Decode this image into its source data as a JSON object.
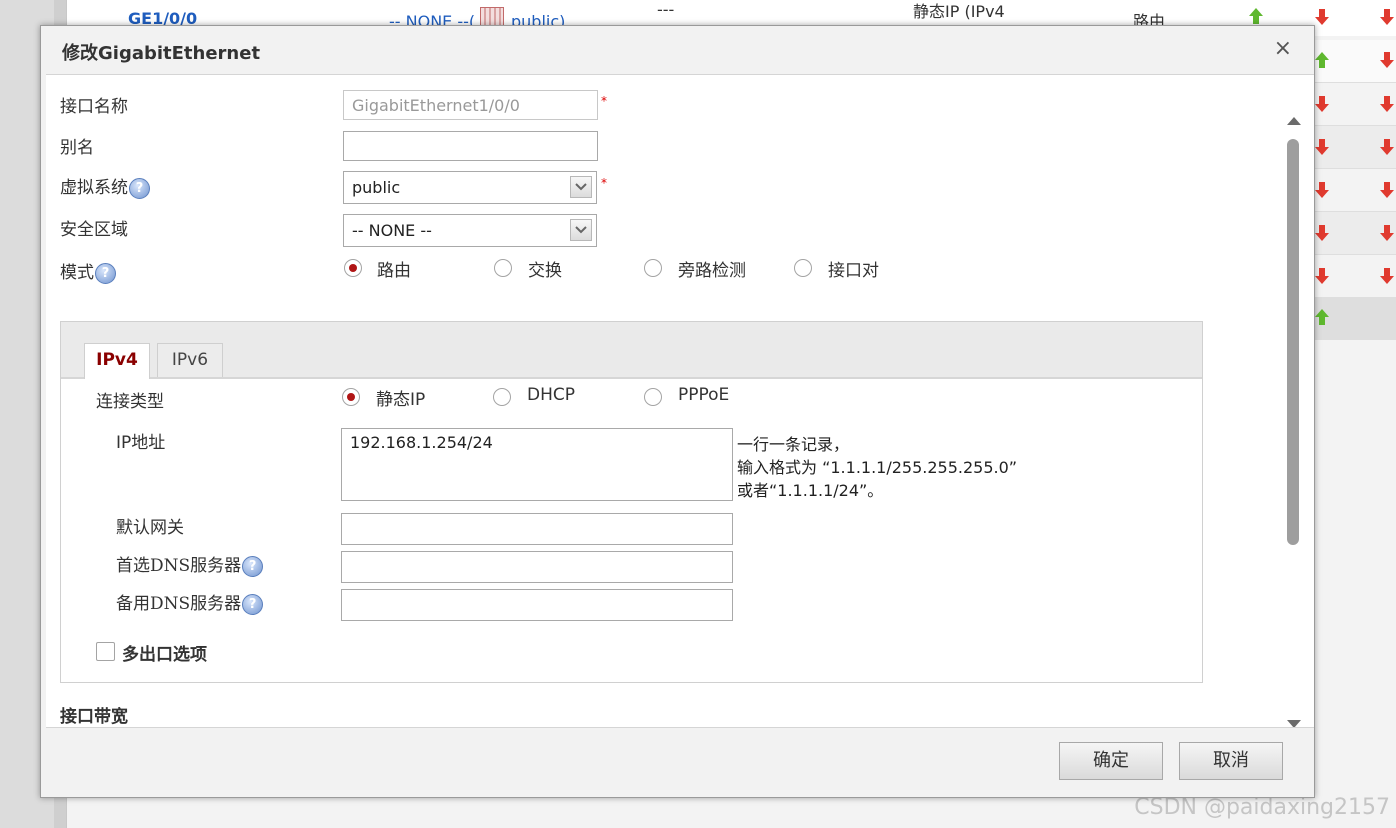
{
  "background": {
    "row0": {
      "interface": "GE1/0/0",
      "zone_text": "-- NONE --(",
      "vsys_link": "public)",
      "dashes": "---",
      "ip_text_1": "静态IP (IPv4",
      "ip_text_2": "静态IP (IPv",
      "mode": "路由"
    },
    "watermark": "CSDN @paidaxing2157"
  },
  "dialog": {
    "title": "修改GigabitEthernet",
    "close_glyph": "×",
    "fields": {
      "interface_name": {
        "label": "接口名称",
        "value": "GigabitEthernet1/0/0",
        "required_mark": "*"
      },
      "alias": {
        "label": "别名",
        "value": ""
      },
      "vsys": {
        "label": "虚拟系统",
        "help": "?",
        "value": "public",
        "required_mark": "*"
      },
      "zone": {
        "label": "安全区域",
        "value": "-- NONE --"
      },
      "mode": {
        "label": "模式",
        "help": "?",
        "options": [
          "路由",
          "交换",
          "旁路检测",
          "接口对"
        ],
        "selected": "路由"
      }
    },
    "ip_panel": {
      "tabs": [
        "IPv4",
        "IPv6"
      ],
      "active_tab": "IPv4",
      "conn_type": {
        "label": "连接类型",
        "options": [
          "静态IP",
          "DHCP",
          "PPPoE"
        ],
        "selected": "静态IP"
      },
      "ip_address": {
        "label": "IP地址",
        "value": "192.168.1.254/24",
        "hint_1": "一行一条记录，",
        "hint_2": "输入格式为 “1.1.1.1/255.255.255.0”",
        "hint_3": "或者“1.1.1.1/24”。"
      },
      "gateway": {
        "label": "默认网关",
        "value": ""
      },
      "dns1": {
        "label": "首选DNS服务器",
        "help": "?",
        "value": ""
      },
      "dns2": {
        "label": "备用DNS服务器",
        "help": "?",
        "value": ""
      },
      "multi_exit": {
        "label": "多出口选项",
        "checked": false
      }
    },
    "bandwidth_section": "接口带宽",
    "buttons": {
      "ok": "确定",
      "cancel": "取消"
    }
  },
  "colors": {
    "link": "#1f5dbe",
    "active_tab": "#8a0000",
    "radio_dot": "#b01515",
    "required": "#dd0000",
    "arrow_up": "#5fb82f",
    "arrow_down": "#e03a2f"
  }
}
